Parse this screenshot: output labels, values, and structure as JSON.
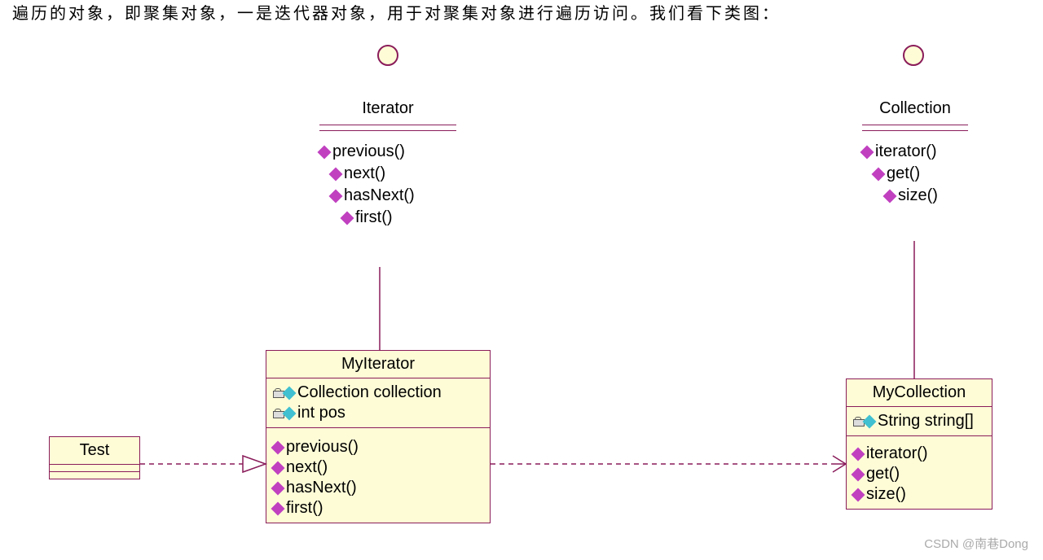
{
  "top_text": "遍历的对象，即聚集对象，一是迭代器对象，用于对聚集对象进行遍历访问。我们看下类图：",
  "interfaces": {
    "iterator": {
      "title": "Iterator",
      "methods": [
        "previous()",
        "next()",
        "hasNext()",
        "first()"
      ]
    },
    "collection": {
      "title": "Collection",
      "methods": [
        "iterator()",
        "get()",
        "size()"
      ]
    }
  },
  "classes": {
    "test": {
      "title": "Test"
    },
    "myIterator": {
      "title": "MyIterator",
      "attributes": [
        "Collection collection",
        "int pos"
      ],
      "methods": [
        "previous()",
        "next()",
        "hasNext()",
        "first()"
      ]
    },
    "myCollection": {
      "title": "MyCollection",
      "attributes": [
        "String string[]"
      ],
      "methods": [
        "iterator()",
        "get()",
        "size()"
      ]
    }
  },
  "watermark": "CSDN @南巷Dong"
}
